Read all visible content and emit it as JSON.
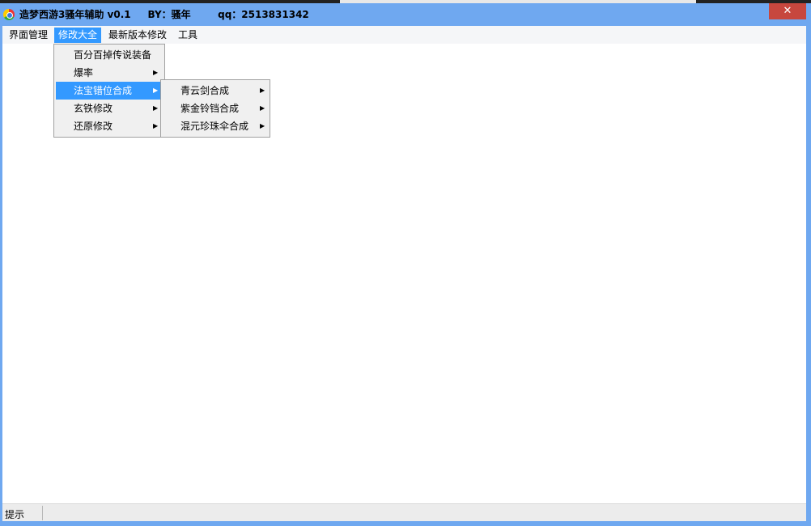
{
  "window": {
    "title": "造梦西游3骚年辅助 v0.1     BY：骚年        qq：2513831342",
    "close_glyph": "✕"
  },
  "menubar": {
    "items": [
      "界面管理",
      "修改大全",
      "最新版本修改",
      "工具"
    ]
  },
  "dropdown": {
    "items": [
      {
        "label": "百分百掉传说装备"
      },
      {
        "label": "爆率"
      },
      {
        "label": "法宝错位合成"
      },
      {
        "label": "玄铁修改"
      },
      {
        "label": "还原修改"
      }
    ]
  },
  "submenu": {
    "items": [
      {
        "label": "青云剑合成"
      },
      {
        "label": "紫金铃铛合成"
      },
      {
        "label": "混元珍珠伞合成"
      }
    ]
  },
  "statusbar": {
    "text": "提示"
  },
  "arrow_glyph": "▶",
  "colors": {
    "titlebar": "#6fa8f0",
    "highlight": "#3399ff",
    "close": "#c7473e"
  }
}
